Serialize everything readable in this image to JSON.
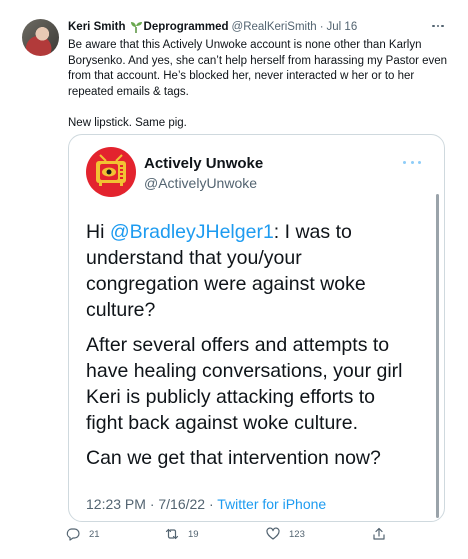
{
  "tweet": {
    "display_name": "Keri Smith",
    "name_suffix": "Deprogrammed",
    "handle": "@RealKeriSmith",
    "separator": "·",
    "date": "Jul 16",
    "icon": "sprout-icon",
    "lines": [
      "Be aware that this Actively Unwoke account is none other than Karlyn",
      "Borysenko. And yes, she can’t help herself from harassing my Pastor even",
      "from that account. He’s blocked her, never interacted w her or to her",
      "repeated emails & tags."
    ],
    "closing_line": "New lipstick. Same pig."
  },
  "quoted": {
    "display_name": "Actively Unwoke",
    "handle": "@ActivelyUnwoke",
    "para1_prefix": "Hi ",
    "mention": "@BradleyJHelger1",
    "para1_first_rest": ": I was to",
    "para1_lines": [
      "understand that you/your",
      "congregation were against woke",
      "culture?"
    ],
    "para2_lines": [
      "After several offers and attempts to",
      "have healing conversations, your girl",
      "Keri is publicly attacking efforts to",
      "fight back against woke culture."
    ],
    "para3_lines": [
      "Can we get that intervention now?"
    ],
    "timestamp": "12:23 PM · 7/16/22 · ",
    "source": "Twitter for iPhone"
  },
  "actions": {
    "reply_count": "21",
    "retweet_count": "19",
    "like_count": "123"
  },
  "colors": {
    "accent": "#1d9bf0",
    "text": "#0f1419",
    "muted": "#536471",
    "border": "#cfd9de",
    "logo_bg": "#e3232e",
    "logo_tv": "#f2c233"
  }
}
